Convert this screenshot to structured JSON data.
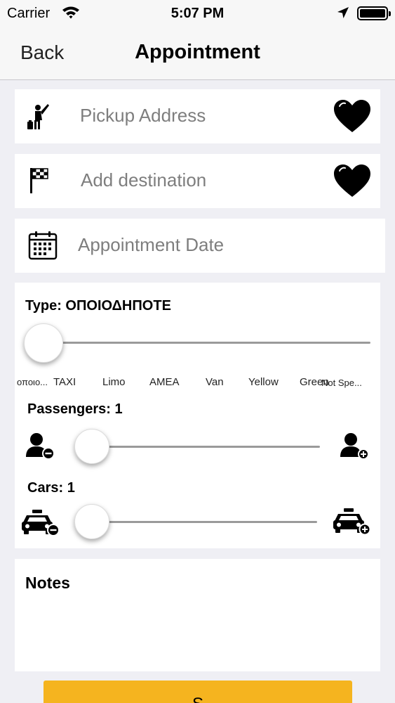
{
  "status_bar": {
    "carrier": "Carrier",
    "time": "5:07 PM"
  },
  "nav": {
    "back_label": "Back",
    "title": "Appointment"
  },
  "pickup": {
    "placeholder": "Pickup Address"
  },
  "destination": {
    "placeholder": "Add destination"
  },
  "date": {
    "placeholder": "Appointment Date"
  },
  "type_slider": {
    "title": "Type: ΟΠΟΙΟΔΗΠΟΤΕ",
    "ticks": [
      "οποιο...",
      "TAXI",
      "Limo",
      "AMEA",
      "Van",
      "Yellow",
      "Green",
      "Not Spe..."
    ],
    "value_index": 0
  },
  "passengers": {
    "title": "Passengers: 1",
    "value": 1
  },
  "cars": {
    "title": "Cars: 1",
    "value": 1
  },
  "notes": {
    "title": "Notes"
  },
  "submit": {
    "label": "S"
  },
  "colors": {
    "accent": "#f5b41f",
    "background": "#efeff4",
    "placeholder": "#7e7e7e"
  }
}
